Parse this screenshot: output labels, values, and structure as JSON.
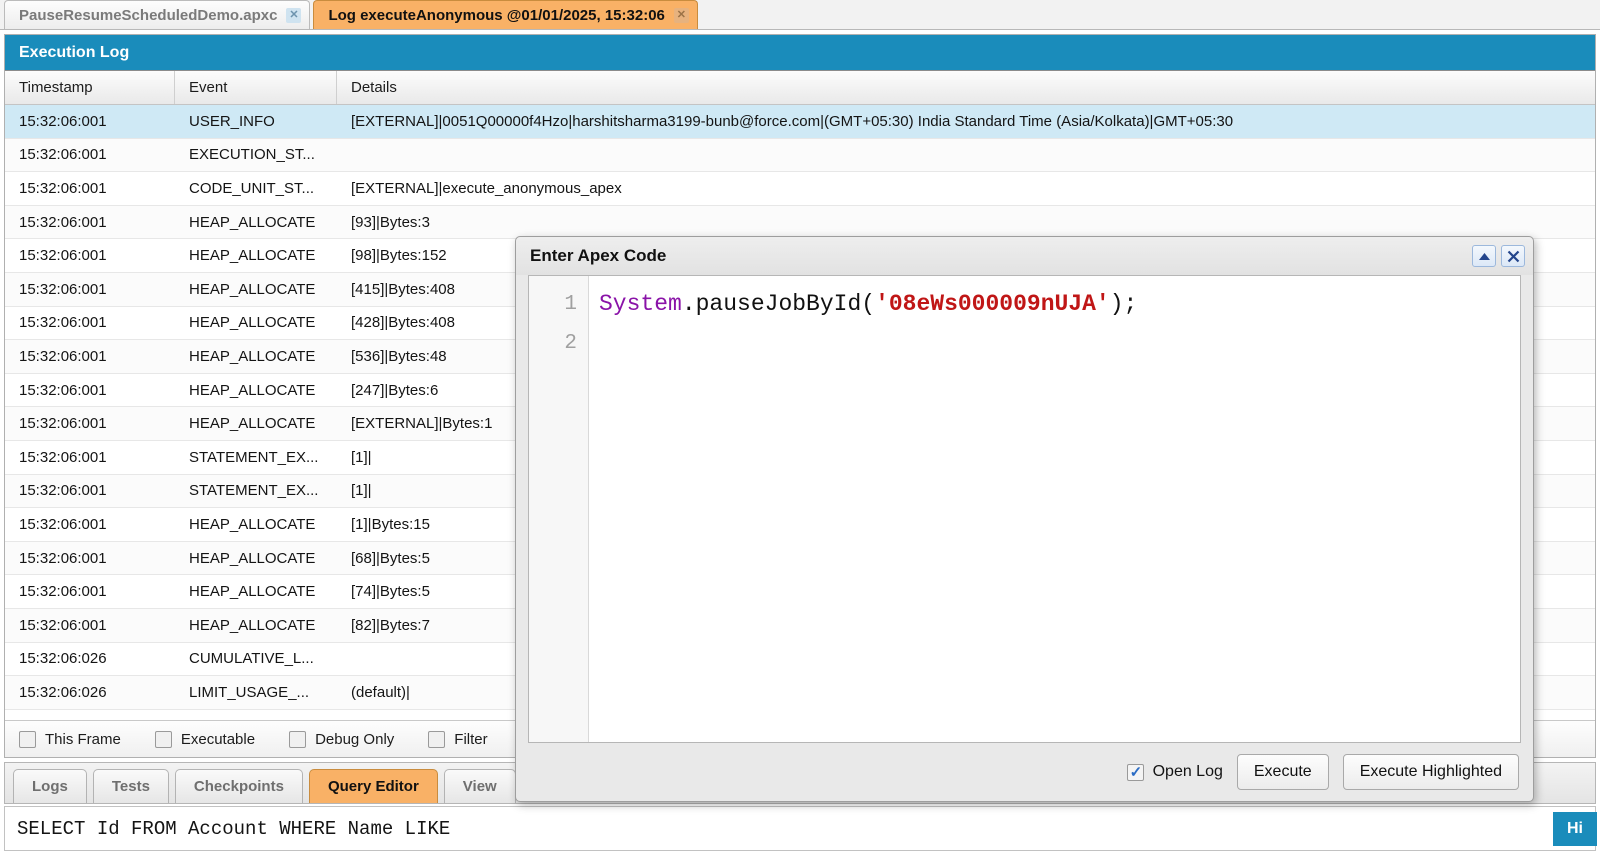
{
  "tabs": [
    {
      "label": "PauseResumeScheduledDemo.apxc",
      "active": false,
      "close_icon": "close-icon"
    },
    {
      "label": "Log executeAnonymous @01/01/2025, 15:32:06",
      "active": true,
      "close_icon": "close-icon"
    }
  ],
  "execution_log": {
    "title": "Execution Log",
    "columns": [
      "Timestamp",
      "Event",
      "Details"
    ],
    "rows": [
      {
        "timestamp": "15:32:06:001",
        "event": "USER_INFO",
        "details": "[EXTERNAL]|0051Q00000f4Hzo|harshitsharma3199-bunb@force.com|(GMT+05:30) India Standard Time (Asia/Kolkata)|GMT+05:30",
        "selected": true
      },
      {
        "timestamp": "15:32:06:001",
        "event": "EXECUTION_ST...",
        "details": "",
        "selected": false
      },
      {
        "timestamp": "15:32:06:001",
        "event": "CODE_UNIT_ST...",
        "details": "[EXTERNAL]|execute_anonymous_apex",
        "selected": false
      },
      {
        "timestamp": "15:32:06:001",
        "event": "HEAP_ALLOCATE",
        "details": "[93]|Bytes:3",
        "selected": false
      },
      {
        "timestamp": "15:32:06:001",
        "event": "HEAP_ALLOCATE",
        "details": "[98]|Bytes:152",
        "selected": false
      },
      {
        "timestamp": "15:32:06:001",
        "event": "HEAP_ALLOCATE",
        "details": "[415]|Bytes:408",
        "selected": false
      },
      {
        "timestamp": "15:32:06:001",
        "event": "HEAP_ALLOCATE",
        "details": "[428]|Bytes:408",
        "selected": false
      },
      {
        "timestamp": "15:32:06:001",
        "event": "HEAP_ALLOCATE",
        "details": "[536]|Bytes:48",
        "selected": false
      },
      {
        "timestamp": "15:32:06:001",
        "event": "HEAP_ALLOCATE",
        "details": "[247]|Bytes:6",
        "selected": false
      },
      {
        "timestamp": "15:32:06:001",
        "event": "HEAP_ALLOCATE",
        "details": "[EXTERNAL]|Bytes:1",
        "selected": false
      },
      {
        "timestamp": "15:32:06:001",
        "event": "STATEMENT_EX...",
        "details": "[1]|",
        "selected": false
      },
      {
        "timestamp": "15:32:06:001",
        "event": "STATEMENT_EX...",
        "details": "[1]|",
        "selected": false
      },
      {
        "timestamp": "15:32:06:001",
        "event": "HEAP_ALLOCATE",
        "details": "[1]|Bytes:15",
        "selected": false
      },
      {
        "timestamp": "15:32:06:001",
        "event": "HEAP_ALLOCATE",
        "details": "[68]|Bytes:5",
        "selected": false
      },
      {
        "timestamp": "15:32:06:001",
        "event": "HEAP_ALLOCATE",
        "details": "[74]|Bytes:5",
        "selected": false
      },
      {
        "timestamp": "15:32:06:001",
        "event": "HEAP_ALLOCATE",
        "details": "[82]|Bytes:7",
        "selected": false
      },
      {
        "timestamp": "15:32:06:026",
        "event": "CUMULATIVE_L...",
        "details": "",
        "selected": false
      },
      {
        "timestamp": "15:32:06:026",
        "event": "LIMIT_USAGE_...",
        "details": "(default)|",
        "selected": false
      }
    ],
    "filters": [
      {
        "label": "This Frame",
        "checked": false
      },
      {
        "label": "Executable",
        "checked": false
      },
      {
        "label": "Debug Only",
        "checked": false
      },
      {
        "label": "Filter",
        "checked": false
      }
    ]
  },
  "lower_tabs": [
    {
      "label": "Logs",
      "active": false
    },
    {
      "label": "Tests",
      "active": false
    },
    {
      "label": "Checkpoints",
      "active": false
    },
    {
      "label": "Query Editor",
      "active": true
    },
    {
      "label": "View",
      "active": false
    }
  ],
  "query_editor": {
    "query": "SELECT Id FROM Account WHERE Name LIKE",
    "history_label": "Hi"
  },
  "apex_dialog": {
    "title": "Enter Apex Code",
    "collapse_icon": "collapse-icon",
    "close_icon": "close-icon",
    "line_numbers": [
      "1",
      "2"
    ],
    "code": {
      "class_token": "System",
      "method_token": ".pauseJobById(",
      "string_token": "'08eWs000009nUJA'",
      "tail_token": ");"
    },
    "open_log": {
      "label": "Open Log",
      "checked": true
    },
    "buttons": [
      {
        "label": "Execute"
      },
      {
        "label": "Execute Highlighted"
      }
    ]
  },
  "colors": {
    "panel_header": "#1a8cbb",
    "active_tab": "#f9b166",
    "row_selected": "#cfe9f5",
    "code_class": "#8a13a8",
    "code_string": "#c01616"
  }
}
